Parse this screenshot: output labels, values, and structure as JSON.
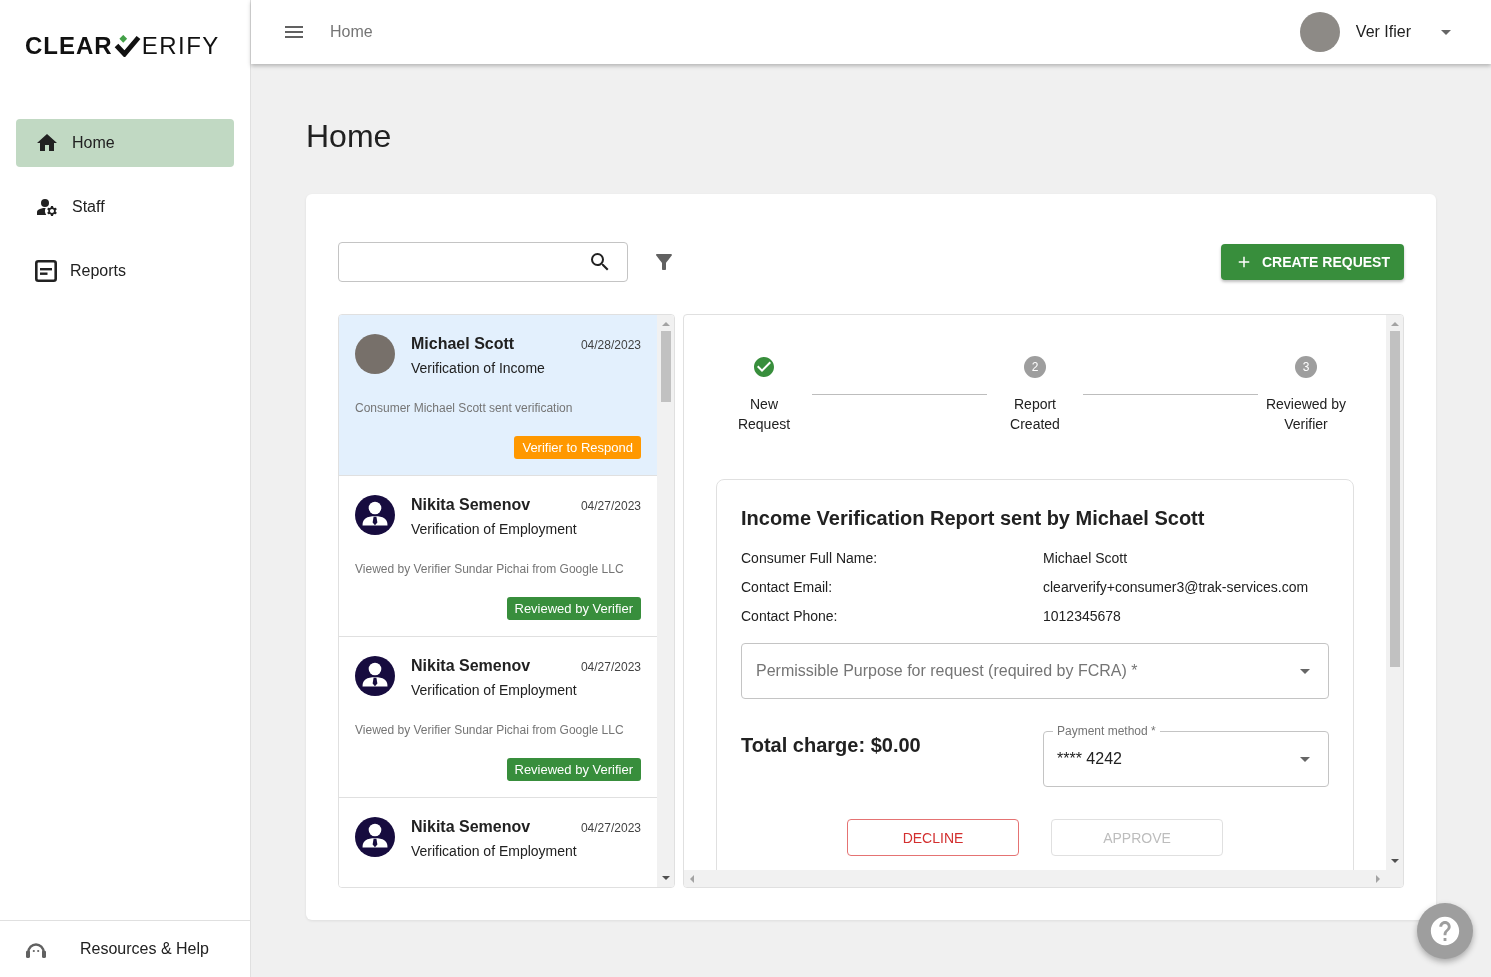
{
  "sidebar": {
    "logo": {
      "text_1": "CLEAR",
      "text_2": "ERIFY"
    },
    "items": [
      {
        "label": "Home",
        "kind": "home",
        "selected": true
      },
      {
        "label": "Staff",
        "kind": "staff",
        "selected": false
      },
      {
        "label": "Reports",
        "kind": "reports",
        "selected": false
      }
    ],
    "footer": {
      "label": "Resources & Help"
    }
  },
  "top_bar": {
    "breadcrumb": "Home",
    "user": {
      "name": "Ver Ifier"
    }
  },
  "page": {
    "title": "Home"
  },
  "toolbar": {
    "create_button": "CREATE REQUEST"
  },
  "requests": [
    {
      "name": "Michael Scott",
      "date": "04/28/2023",
      "type": "Verification of Income",
      "note": "Consumer Michael Scott sent verification",
      "status": {
        "label": "Verifier to Respond",
        "color": "#ff9800"
      },
      "avatar": {
        "kind": "photo"
      },
      "selected": true
    },
    {
      "name": "Nikita Semenov",
      "date": "04/27/2023",
      "type": "Verification of Employment",
      "note": "Viewed by Verifier Sundar Pichai from Google LLC",
      "status": {
        "label": "Reviewed by Verifier",
        "color": "#388e3c"
      },
      "avatar": {
        "kind": "generic"
      },
      "selected": false
    },
    {
      "name": "Nikita Semenov",
      "date": "04/27/2023",
      "type": "Verification of Employment",
      "note": "Viewed by Verifier Sundar Pichai from Google LLC",
      "status": {
        "label": "Reviewed by Verifier",
        "color": "#388e3c"
      },
      "avatar": {
        "kind": "generic"
      },
      "selected": false
    },
    {
      "name": "Nikita Semenov",
      "date": "04/27/2023",
      "type": "Verification of Employment",
      "avatar": {
        "kind": "generic"
      },
      "selected": false
    }
  ],
  "detail": {
    "steps": [
      {
        "label": "New Request",
        "completed": true
      },
      {
        "label": "Report Created",
        "number": "2",
        "completed": false
      },
      {
        "label": "Reviewed by Verifier",
        "number": "3",
        "completed": false
      }
    ],
    "report": {
      "title": "Income Verification Report sent by Michael Scott",
      "fields": [
        {
          "label": "Consumer Full Name:",
          "value": "Michael Scott"
        },
        {
          "label": "Contact Email:",
          "value": "clearverify+consumer3@trak-services.com"
        },
        {
          "label": "Contact Phone:",
          "value": "1012345678"
        }
      ],
      "purpose_select": {
        "placeholder": "Permissible Purpose for request (required by FCRA) *"
      },
      "total": "Total charge: $0.00",
      "payment": {
        "label": "Payment method *",
        "value": "**** 4242"
      },
      "actions": [
        {
          "label": "DECLINE",
          "kind": "decline",
          "disabled": false
        },
        {
          "label": "APPROVE",
          "kind": "approve",
          "disabled": true
        }
      ]
    }
  }
}
